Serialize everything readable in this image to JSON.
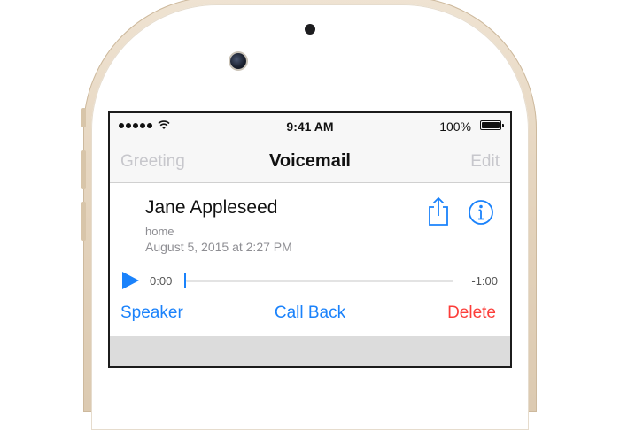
{
  "status_bar": {
    "time": "9:41 AM",
    "battery": "100%"
  },
  "nav": {
    "left": "Greeting",
    "title": "Voicemail",
    "right": "Edit"
  },
  "voicemail": {
    "name": "Jane Appleseed",
    "label": "home",
    "date": "August 5, 2015 at 2:27 PM",
    "elapsed": "0:00",
    "remaining": "-1:00",
    "progress": 0
  },
  "actions": {
    "speaker": "Speaker",
    "call_back": "Call Back",
    "delete": "Delete"
  },
  "icons": {
    "share": "share-icon",
    "info": "info-icon",
    "play": "play-icon"
  },
  "colors": {
    "accent": "#1a82fb",
    "destructive": "#fc3d39",
    "disabled": "#c7c7cc"
  }
}
